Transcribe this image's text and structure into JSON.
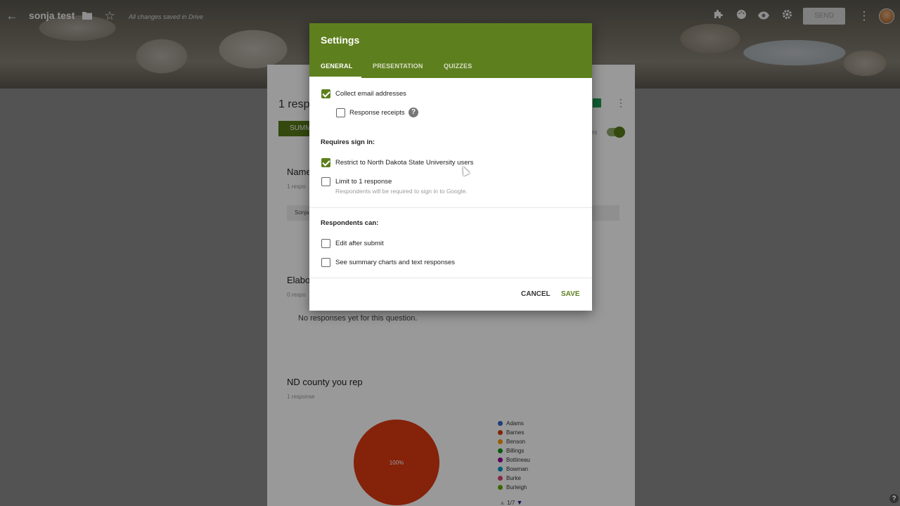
{
  "topbar": {
    "doc_title": "sonja test",
    "saved_note": "All changes saved in Drive",
    "send_label": "SEND",
    "icons": [
      "back-arrow-icon",
      "folder-icon",
      "star-icon",
      "addon-icon",
      "palette-icon",
      "preview-eye-icon",
      "settings-gear-icon",
      "more-vert-icon"
    ]
  },
  "form_card": {
    "responses_title": "1 resp",
    "summary_tab": "SUMM",
    "questions": [
      {
        "title": "Name",
        "count": "1 respo",
        "bar_value": "Sonja"
      },
      {
        "title": "Elabo",
        "count": "0 respo",
        "empty_text": "No responses yet for this question."
      },
      {
        "title": "ND county you rep",
        "count": "1 response"
      }
    ]
  },
  "chart_data": {
    "type": "pie",
    "slices": [
      {
        "label": "Barnes",
        "value": 100
      }
    ],
    "slice_label": "100%",
    "legend": [
      {
        "label": "Adams",
        "color": "#3366cc"
      },
      {
        "label": "Barnes",
        "color": "#dc3912"
      },
      {
        "label": "Benson",
        "color": "#ff9900"
      },
      {
        "label": "Billings",
        "color": "#109618"
      },
      {
        "label": "Bottineau",
        "color": "#990099"
      },
      {
        "label": "Bowman",
        "color": "#0099c6"
      },
      {
        "label": "Burke",
        "color": "#dd4477"
      },
      {
        "label": "Burleigh",
        "color": "#66aa00"
      }
    ],
    "legend_page": "1/7"
  },
  "dialog": {
    "title": "Settings",
    "tabs": [
      "GENERAL",
      "PRESENTATION",
      "QUIZZES"
    ],
    "active_tab": "GENERAL",
    "collect_email": {
      "label": "Collect email addresses",
      "checked": true
    },
    "response_receipts": {
      "label": "Response receipts",
      "checked": false,
      "help": "?"
    },
    "requires_sign_in": "Requires sign in:",
    "restrict": {
      "label": "Restrict to North Dakota State University users",
      "checked": true
    },
    "limit_one": {
      "label": "Limit to 1 response",
      "sub": "Respondents will be required to sign in to Google.",
      "checked": false
    },
    "respondents_can": "Respondents can:",
    "edit_after": {
      "label": "Edit after submit",
      "checked": false
    },
    "see_summary": {
      "label": "See summary charts and text responses",
      "checked": false
    },
    "cancel_label": "CANCEL",
    "save_label": "SAVE",
    "accent_color": "#5e7f1e"
  },
  "help_label": "?"
}
